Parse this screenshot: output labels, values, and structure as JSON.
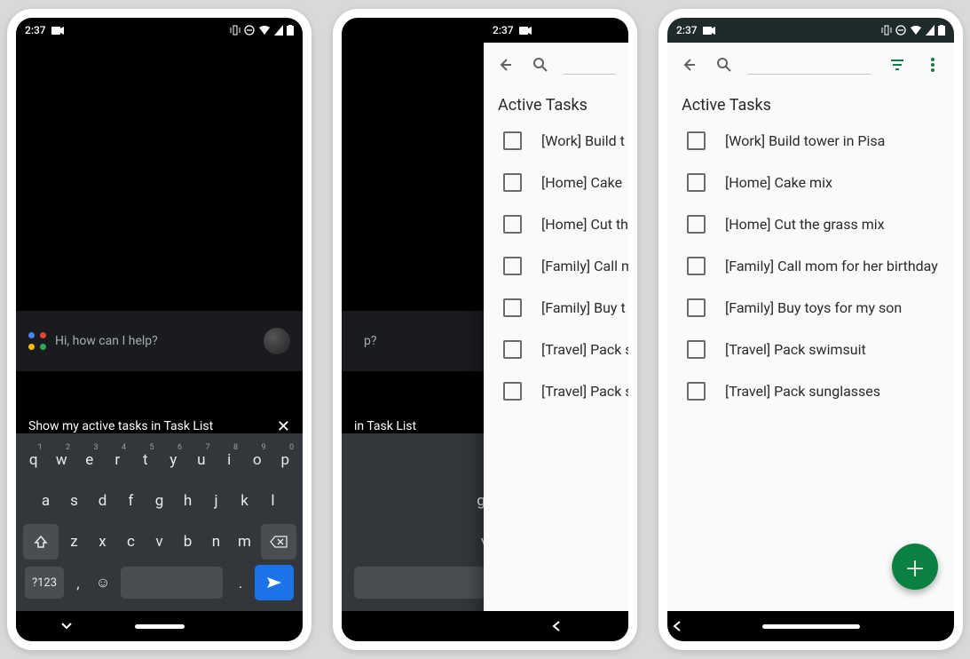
{
  "status": {
    "time": "2:37"
  },
  "assistant": {
    "greeting": "Hi, how can I help?",
    "query": "Show my active tasks in Task List",
    "query_partial": "in Task List"
  },
  "keyboard": {
    "row1": [
      "q",
      "w",
      "e",
      "r",
      "t",
      "y",
      "u",
      "i",
      "o",
      "p"
    ],
    "row1_nums": [
      "1",
      "2",
      "3",
      "4",
      "5",
      "6",
      "7",
      "8",
      "9",
      "0"
    ],
    "row2": [
      "a",
      "s",
      "d",
      "f",
      "g",
      "h",
      "j",
      "k",
      "l"
    ],
    "row3": [
      "z",
      "x",
      "c",
      "v",
      "b",
      "n",
      "m"
    ],
    "sym_label": "?123"
  },
  "tasks": {
    "heading": "Active Tasks",
    "items": [
      "[Work] Build tower in Pisa",
      "[Home] Cake mix",
      "[Home] Cut the grass mix",
      "[Family] Call mom for her birthday",
      "[Family] Buy toys for my son",
      "[Travel] Pack swimsuit",
      "[Travel] Pack sunglasses"
    ],
    "items_truncated": [
      "[Work] Build t",
      "[Home] Cake",
      "[Home] Cut th",
      "[Family] Call m",
      "[Family] Buy t",
      "[Travel] Pack s",
      "[Travel] Pack s"
    ]
  }
}
